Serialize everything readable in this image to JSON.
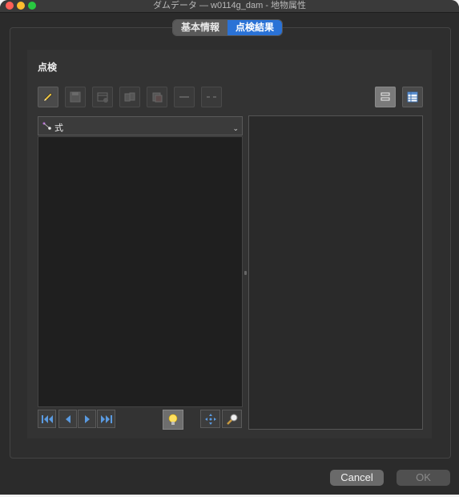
{
  "window": {
    "title": "ダムデータ — w0114g_dam - 地物属性"
  },
  "tabs": [
    {
      "label": "基本情報",
      "active": false
    },
    {
      "label": "点検結果",
      "active": true
    }
  ],
  "panel": {
    "title": "点検"
  },
  "toolbar": {
    "buttons": [
      {
        "icon": "pencil-icon",
        "enabled": true
      },
      {
        "icon": "save-icon",
        "enabled": false
      },
      {
        "icon": "add-feature-icon",
        "enabled": false
      },
      {
        "icon": "copy-icon",
        "enabled": false
      },
      {
        "icon": "delete-icon",
        "enabled": false
      },
      {
        "icon": "link-icon",
        "enabled": false
      },
      {
        "icon": "unlink-icon",
        "enabled": false
      }
    ],
    "view_buttons": [
      {
        "icon": "form-view-icon",
        "pressed": true
      },
      {
        "icon": "table-view-icon",
        "pressed": false
      }
    ]
  },
  "expression": {
    "label": "式"
  },
  "navigation": {
    "icons": [
      "first-icon",
      "previous-icon",
      "next-icon",
      "last-icon"
    ],
    "highlight_icon": "lightbulb-icon",
    "pan_icon": "pan-icon",
    "zoom_icon": "zoom-icon"
  },
  "footer": {
    "cancel_label": "Cancel",
    "ok_label": "OK",
    "ok_enabled": false
  },
  "colors": {
    "accent": "#2a72d6",
    "background": "#2b2b2b"
  }
}
